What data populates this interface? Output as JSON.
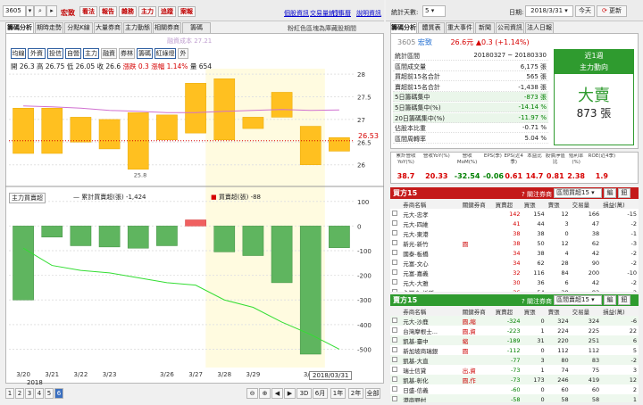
{
  "toolbar": {
    "stock": "3605",
    "stock_name": "宏致",
    "buttons": [
      "看法",
      "報告",
      "雜務",
      "主力",
      "追蹤",
      "案報"
    ],
    "links": [
      "個股資訊",
      "交易量統計",
      "行事曆",
      "說明資訊"
    ]
  },
  "left_tabs": [
    "籌碼分析",
    "期時走勢",
    "分點K線",
    "大量券商",
    "主力動態",
    "相關券商",
    "籌碼"
  ],
  "right_note": "粉紅色區塊為庫藏股期間",
  "sub_tabs": [
    "均線",
    "外資",
    "投信",
    "自營",
    "主力",
    "融資",
    "券林",
    "籌碼",
    "紅綠燈",
    "外"
  ],
  "sub_tab_checked": [
    true,
    true,
    true,
    true,
    true,
    false,
    false,
    true,
    true,
    false
  ],
  "quote": {
    "open_l": "開",
    "open": "26.3",
    "high_l": "高",
    "high": "26.75",
    "low_l": "低",
    "low": "26.05",
    "close_l": "收",
    "close": "26.6",
    "chg_l": "漲跌",
    "chg": "0.3",
    "pct_l": "漲幅",
    "pct": "1.14%",
    "vol_l": "量",
    "vol": "654"
  },
  "ma_label": "融資成本 27.21",
  "price_label": "26.53",
  "low_mark": "25.8",
  "lower_panel": {
    "title": "主力買賣超",
    "legend1": "累計買賣超(張)",
    "legend1_val": "-1,424",
    "legend2": "買賣超(張)",
    "legend2_val": "-88"
  },
  "bottom": {
    "date_box": "2018/03/31",
    "year": "2018",
    "pages": [
      "1",
      "2",
      "3",
      "4",
      "5",
      "6"
    ],
    "active_page": "6",
    "ranges": [
      "3D",
      "6月",
      "1年",
      "2年",
      "全部"
    ],
    "last": "寶寶"
  },
  "right_top": {
    "days_label": "統計天數:",
    "days": "5",
    "date_label": "日期:",
    "date": "2018/3/31",
    "today": "今天",
    "refresh": "更新"
  },
  "right_tabs": [
    "籌碼分析",
    "體質表",
    "重大事件",
    "新聞",
    "公司資訊",
    "法人日報"
  ],
  "stock_line": {
    "code": "3605",
    "name": "宏致",
    "price": "26.6元",
    "chg": "▲0.3 (+1.14%)"
  },
  "stats": [
    {
      "label": "統計區間",
      "value": "20180327 ~ 20180330",
      "style": ""
    },
    {
      "label": "區間成交量",
      "value": "6,175 張",
      "style": ""
    },
    {
      "label": "買超前15名合計",
      "value": "565 張",
      "style": ""
    },
    {
      "label": "賣超前15名合計",
      "value": "-1,438 張",
      "style": ""
    },
    {
      "label": "5日籌碼集中",
      "value": "-873 張",
      "style": "grn"
    },
    {
      "label": "5日籌碼集中(%)",
      "value": "-14.14 %",
      "style": "grn"
    },
    {
      "label": "20日籌碼集中(%)",
      "value": "-11.97 %",
      "style": "grn"
    },
    {
      "label": "佔股本比重",
      "value": "-0.71 %",
      "style": ""
    },
    {
      "label": "區間周轉率",
      "value": "5.04 %",
      "style": ""
    }
  ],
  "green_box": {
    "line1": "近1週",
    "line2": "主力動向",
    "big": "大賣",
    "amount": "873 張"
  },
  "metrics": {
    "heads": [
      "累計營收YoY(%)",
      "營收YoY(%)",
      "營收MoM(%)",
      "EPS(季)",
      "EPS(近4季)",
      "本益比",
      "股價淨值比",
      "殖利率(%)",
      "ROE(近4季)"
    ],
    "values": [
      "38.7",
      "20.33",
      "-32.54",
      "-0.06",
      "0.61",
      "14.7",
      "0.81",
      "2.38",
      "1.9"
    ]
  },
  "buy": {
    "title": "買方15",
    "note": "關注券商",
    "select": "區間買超15",
    "heads": [
      "券商名稱",
      "關鍵券商",
      "買賣超",
      "買張",
      "賣張",
      "交易量",
      "損益(萬)"
    ],
    "rows": [
      [
        "元大-忠孝",
        "",
        "142",
        "154",
        "12",
        "166",
        "-15"
      ],
      [
        "元大-四維",
        "",
        "41",
        "44",
        "3",
        "47",
        "-2"
      ],
      [
        "元大-東港",
        "",
        "38",
        "38",
        "0",
        "38",
        "-1"
      ],
      [
        "新光-新竹",
        "圓",
        "38",
        "50",
        "12",
        "62",
        "-3"
      ],
      [
        "國泰-板橋",
        "",
        "34",
        "38",
        "4",
        "42",
        "-2"
      ],
      [
        "元富-文心",
        "",
        "34",
        "62",
        "28",
        "90",
        "-2"
      ],
      [
        "元富-嘉義",
        "",
        "32",
        "116",
        "84",
        "200",
        "-10"
      ],
      [
        "元大-大雅",
        "",
        "30",
        "36",
        "6",
        "42",
        "-2"
      ],
      [
        "永豐金-板新",
        "",
        "26",
        "54",
        "28",
        "82",
        "-2"
      ]
    ]
  },
  "sell": {
    "title": "賣方15",
    "note": "關注券商",
    "select": "區間賣超15",
    "heads": [
      "券商名稱",
      "關鍵券商",
      "買賣超",
      "買張",
      "賣張",
      "交易量",
      "損益(萬)"
    ],
    "rows": [
      [
        "元大-沙鹿",
        "圓,縮",
        "-324",
        "0",
        "324",
        "324",
        "-6"
      ],
      [
        "台灣摩根士...",
        "圓,資",
        "-223",
        "1",
        "224",
        "225",
        "22"
      ],
      [
        "凱基-臺中",
        "縮",
        "-189",
        "31",
        "220",
        "251",
        "6"
      ],
      [
        "新加坡商瑞銀",
        "圓",
        "-112",
        "0",
        "112",
        "112",
        "5"
      ],
      [
        "凱基-大直",
        "",
        "-77",
        "3",
        "80",
        "83",
        "-2"
      ],
      [
        "瑞士信貸",
        "出,資",
        "-73",
        "1",
        "74",
        "75",
        "3"
      ],
      [
        "凱基-彰化",
        "圓,作",
        "-73",
        "173",
        "246",
        "419",
        "12"
      ],
      [
        "日盛-信義",
        "",
        "-60",
        "0",
        "60",
        "60",
        "2"
      ],
      [
        "港商野村",
        "",
        "-58",
        "0",
        "58",
        "58",
        "1"
      ]
    ]
  },
  "chart_data": {
    "type": "candlestick+bar",
    "x": [
      "3/20",
      "3/21",
      "3/22",
      "3/23",
      "3/26",
      "3/27",
      "3/28",
      "3/29",
      "3/30"
    ],
    "candles": [
      {
        "open": 27.25,
        "close": 26.25
      },
      {
        "open": 27.25,
        "close": 26.25
      },
      {
        "open": 27.05,
        "close": 26.5
      },
      {
        "open": 27.0,
        "close": 26.35
      },
      {
        "open": 27.15,
        "close": 25.9
      },
      {
        "open": 27.1,
        "close": 26.55
      },
      {
        "open": 27.8,
        "close": 26.7
      },
      {
        "open": 27.9,
        "close": 26.55
      },
      {
        "open": 27.05,
        "close": 26.8
      },
      {
        "open": 27.6,
        "close": 27.05
      },
      {
        "open": 26.85,
        "close": 26.0
      },
      {
        "open": 26.3,
        "close": 26.6
      }
    ],
    "ma": [
      27.3,
      27.28,
      27.25,
      27.2,
      27.18,
      27.15,
      27.15,
      27.18,
      27.2,
      27.22,
      27.2,
      27.21
    ],
    "y_upper": [
      28,
      27.5,
      27,
      26.5,
      26
    ],
    "bars": [
      -300,
      -45,
      -80,
      -85,
      -90,
      -80,
      25,
      -105,
      -120,
      -230,
      -520,
      -88
    ],
    "cumulative": [
      -90,
      -160,
      -180,
      -190,
      -210,
      -230,
      -240,
      -300,
      -330,
      -390,
      -440,
      -500
    ],
    "y_lower": [
      100,
      0,
      -100,
      -200,
      -300,
      -400,
      -500
    ]
  }
}
